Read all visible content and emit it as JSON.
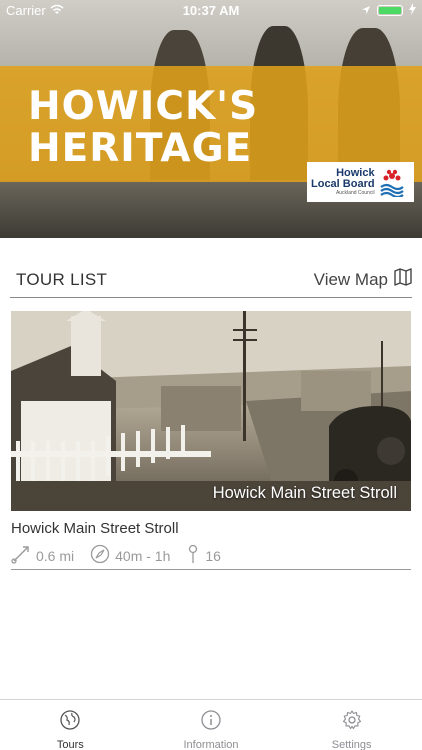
{
  "status_bar": {
    "carrier": "Carrier",
    "time": "10:37 AM"
  },
  "hero": {
    "title_line1": "HOWICK'S",
    "title_line2": "HERITAGE",
    "logo": {
      "line1": "Howick",
      "line2": "Local Board",
      "line3": "Auckland Council"
    },
    "band_color": "#e2a218"
  },
  "tour_list": {
    "heading": "TOUR LIST",
    "view_map_label": "View Map",
    "tours": [
      {
        "image_caption": "Howick Main Street Stroll",
        "title": "Howick Main Street Stroll",
        "distance": "0.6 mi",
        "duration": "40m - 1h",
        "stops": "16"
      }
    ]
  },
  "tab_bar": {
    "tabs": [
      {
        "label": "Tours",
        "icon": "globe-icon",
        "active": true
      },
      {
        "label": "Information",
        "icon": "info-icon",
        "active": false
      },
      {
        "label": "Settings",
        "icon": "gear-icon",
        "active": false
      }
    ]
  }
}
